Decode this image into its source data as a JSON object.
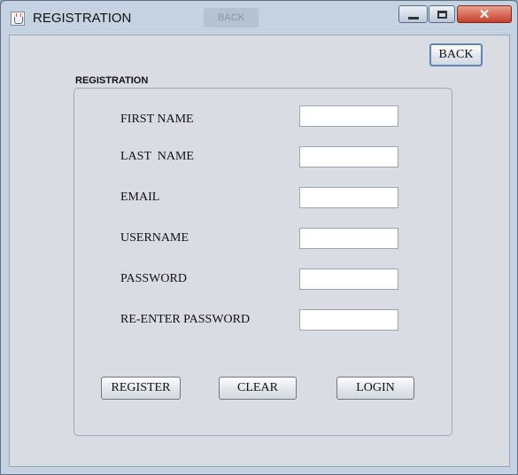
{
  "window": {
    "title": "REGISTRATION",
    "ghost_text": "BACK"
  },
  "toolbar": {
    "back_label": "BACK"
  },
  "form": {
    "group_title": "REGISTRATION",
    "fields": [
      {
        "label": "FIRST NAME",
        "value": ""
      },
      {
        "label": "LAST  NAME",
        "value": ""
      },
      {
        "label": "EMAIL",
        "value": ""
      },
      {
        "label": "USERNAME",
        "value": ""
      },
      {
        "label": "PASSWORD",
        "value": ""
      },
      {
        "label": "RE-ENTER PASSWORD",
        "value": ""
      }
    ],
    "buttons": {
      "register": "REGISTER",
      "clear": "CLEAR",
      "login": "LOGIN"
    }
  },
  "colors": {
    "title_bar": "#c5d2e1",
    "panel": "#d9dce3",
    "close_button": "#c4402a"
  }
}
